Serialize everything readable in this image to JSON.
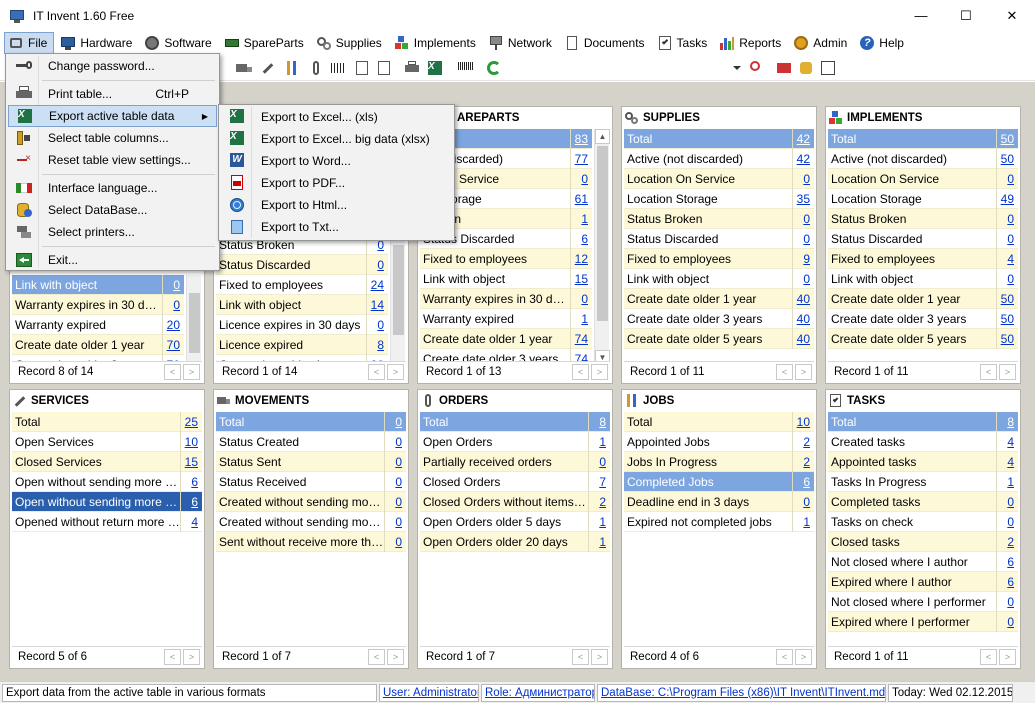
{
  "window": {
    "title": "IT Invent 1.60 Free",
    "minimize": "—",
    "maximize": "☐",
    "close": "✕"
  },
  "menubar": [
    "File",
    "Hardware",
    "Software",
    "SpareParts",
    "Supplies",
    "Implements",
    "Network",
    "Documents",
    "Tasks",
    "Reports",
    "Admin",
    "Help"
  ],
  "file_menu": {
    "change_password": "Change password...",
    "print_table": "Print table...",
    "print_shortcut": "Ctrl+P",
    "export_active": "Export active table data",
    "select_columns": "Select table columns...",
    "reset_view": "Reset table view settings...",
    "interface_language": "Interface language...",
    "select_database": "Select DataBase...",
    "select_printers": "Select printers...",
    "exit": "Exit..."
  },
  "export_menu": {
    "excel_xls": "Export to Excel... (xls)",
    "excel_xlsx": "Export to Excel... big data (xlsx)",
    "word": "Export to Word...",
    "pdf": "Export to PDF...",
    "html": "Export to Html...",
    "txt": "Export to Txt..."
  },
  "panels": {
    "hardware": {
      "rows": [
        {
          "label": "Link with object",
          "value": "0"
        },
        {
          "label": "Warranty expires in 30 days",
          "value": "0"
        },
        {
          "label": "Warranty expired",
          "value": "20"
        },
        {
          "label": "Create date older 1 year",
          "value": "70"
        },
        {
          "label": "Create date older 3 years",
          "value": "70"
        }
      ],
      "record": "Record 8 of 14"
    },
    "software": {
      "rows": [
        {
          "label": "Status Broken",
          "value": "0"
        },
        {
          "label": "Status Discarded",
          "value": "0"
        },
        {
          "label": "Fixed to employees",
          "value": "24"
        },
        {
          "label": "Link with object",
          "value": "14"
        },
        {
          "label": "Licence expires in 30 days",
          "value": "0"
        },
        {
          "label": "Licence expired",
          "value": "8"
        },
        {
          "label": "Create date older 1 year",
          "value": "80"
        }
      ],
      "record": "Record 1 of 14"
    },
    "spareparts": {
      "title": "AREPARTS",
      "rows": [
        {
          "label": "",
          "value": "83"
        },
        {
          "label": "(not discarded)",
          "value": "77"
        },
        {
          "label": "on On Service",
          "value": "0"
        },
        {
          "label": "on Storage",
          "value": "61"
        },
        {
          "label": "Broken",
          "value": "1"
        },
        {
          "label": "Status Discarded",
          "value": "6"
        },
        {
          "label": "Fixed to employees",
          "value": "12"
        },
        {
          "label": "Link with object",
          "value": "15"
        },
        {
          "label": "Warranty expires in 30 days",
          "value": "0"
        },
        {
          "label": "Warranty expired",
          "value": "1"
        },
        {
          "label": "Create date older 1 year",
          "value": "74"
        },
        {
          "label": "Create date older 3 years",
          "value": "74"
        }
      ],
      "record": "Record 1 of 13"
    },
    "supplies": {
      "title": "SUPPLIES",
      "rows": [
        {
          "label": "Total",
          "value": "42"
        },
        {
          "label": "Active (not discarded)",
          "value": "42"
        },
        {
          "label": "Location On Service",
          "value": "0"
        },
        {
          "label": "Location Storage",
          "value": "35"
        },
        {
          "label": "Status Broken",
          "value": "0"
        },
        {
          "label": "Status Discarded",
          "value": "0"
        },
        {
          "label": "Fixed to employees",
          "value": "9"
        },
        {
          "label": "Link with object",
          "value": "0"
        },
        {
          "label": "Create date older 1 year",
          "value": "40"
        },
        {
          "label": "Create date older 3 years",
          "value": "40"
        },
        {
          "label": "Create date older 5 years",
          "value": "40"
        }
      ],
      "record": "Record 1 of 11"
    },
    "implements": {
      "title": "IMPLEMENTS",
      "rows": [
        {
          "label": "Total",
          "value": "50"
        },
        {
          "label": "Active (not discarded)",
          "value": "50"
        },
        {
          "label": "Location On Service",
          "value": "0"
        },
        {
          "label": "Location Storage",
          "value": "49"
        },
        {
          "label": "Status Broken",
          "value": "0"
        },
        {
          "label": "Status Discarded",
          "value": "0"
        },
        {
          "label": "Fixed to employees",
          "value": "4"
        },
        {
          "label": "Link with object",
          "value": "0"
        },
        {
          "label": "Create date older 1 year",
          "value": "50"
        },
        {
          "label": "Create date older 3 years",
          "value": "50"
        },
        {
          "label": "Create date older 5 years",
          "value": "50"
        }
      ],
      "record": "Record 1 of 11"
    },
    "services": {
      "title": "SERVICES",
      "rows": [
        {
          "label": "Total",
          "value": "25"
        },
        {
          "label": "Open Services",
          "value": "10"
        },
        {
          "label": "Closed Services",
          "value": "15"
        },
        {
          "label": "Open without sending more th...",
          "value": "6"
        },
        {
          "label": "Open without sending more th...",
          "value": "6"
        },
        {
          "label": "Opened without return more th...",
          "value": "4"
        }
      ],
      "record": "Record 5 of 6"
    },
    "movements": {
      "title": "MOVEMENTS",
      "rows": [
        {
          "label": "Total",
          "value": "0"
        },
        {
          "label": "Status Created",
          "value": "0"
        },
        {
          "label": "Status Sent",
          "value": "0"
        },
        {
          "label": "Status Received",
          "value": "0"
        },
        {
          "label": "Created without sending more ...",
          "value": "0"
        },
        {
          "label": "Created without sending more ...",
          "value": "0"
        },
        {
          "label": "Sent without receive more the...",
          "value": "0"
        }
      ],
      "record": "Record 1 of 7"
    },
    "orders": {
      "title": "ORDERS",
      "rows": [
        {
          "label": "Total",
          "value": "8"
        },
        {
          "label": "Open Orders",
          "value": "1"
        },
        {
          "label": "Partially received orders",
          "value": "0"
        },
        {
          "label": "Closed Orders",
          "value": "7"
        },
        {
          "label": "Closed Orders without items a...",
          "value": "2"
        },
        {
          "label": "Open Orders older 5 days",
          "value": "1"
        },
        {
          "label": "Open Orders older 20 days",
          "value": "1"
        }
      ],
      "record": "Record 1 of 7"
    },
    "jobs": {
      "title": "JOBS",
      "rows": [
        {
          "label": "Total",
          "value": "10"
        },
        {
          "label": "Appointed Jobs",
          "value": "2"
        },
        {
          "label": "Jobs In Progress",
          "value": "2"
        },
        {
          "label": "Completed Jobs",
          "value": "6"
        },
        {
          "label": "Deadline end in 3 days",
          "value": "0"
        },
        {
          "label": "Expired not completed jobs",
          "value": "1"
        }
      ],
      "record": "Record 4 of 6"
    },
    "tasks": {
      "title": "TASKS",
      "rows": [
        {
          "label": "Total",
          "value": "8"
        },
        {
          "label": "Created tasks",
          "value": "4"
        },
        {
          "label": "Appointed tasks",
          "value": "4"
        },
        {
          "label": "Tasks In Progress",
          "value": "1"
        },
        {
          "label": "Completed tasks",
          "value": "0"
        },
        {
          "label": "Tasks on check",
          "value": "0"
        },
        {
          "label": "Closed tasks",
          "value": "2"
        },
        {
          "label": "Not closed where I author",
          "value": "6"
        },
        {
          "label": "Expired where I author",
          "value": "6"
        },
        {
          "label": "Not closed where I performer",
          "value": "0"
        },
        {
          "label": "Expired where I performer",
          "value": "0"
        }
      ],
      "record": "Record 1 of 11"
    }
  },
  "statusbar": {
    "hint": "Export data from the active table in various formats",
    "user": "User: Administrator",
    "role": "Role: Администратор",
    "database": "DataBase: C:\\Program Files (x86)\\IT Invent\\ITInvent.mdb",
    "today": "Today: Wed 02.12.2015"
  },
  "nav": {
    "prev": "<",
    "next": ">",
    "up": "▲",
    "down": "▼"
  },
  "colors": {
    "selection": "#7da6e0",
    "active_selection": "#2a5fae",
    "row_alt": "#fdf9d8",
    "link": "#0033cc",
    "workspace": "#d5d2ca"
  }
}
